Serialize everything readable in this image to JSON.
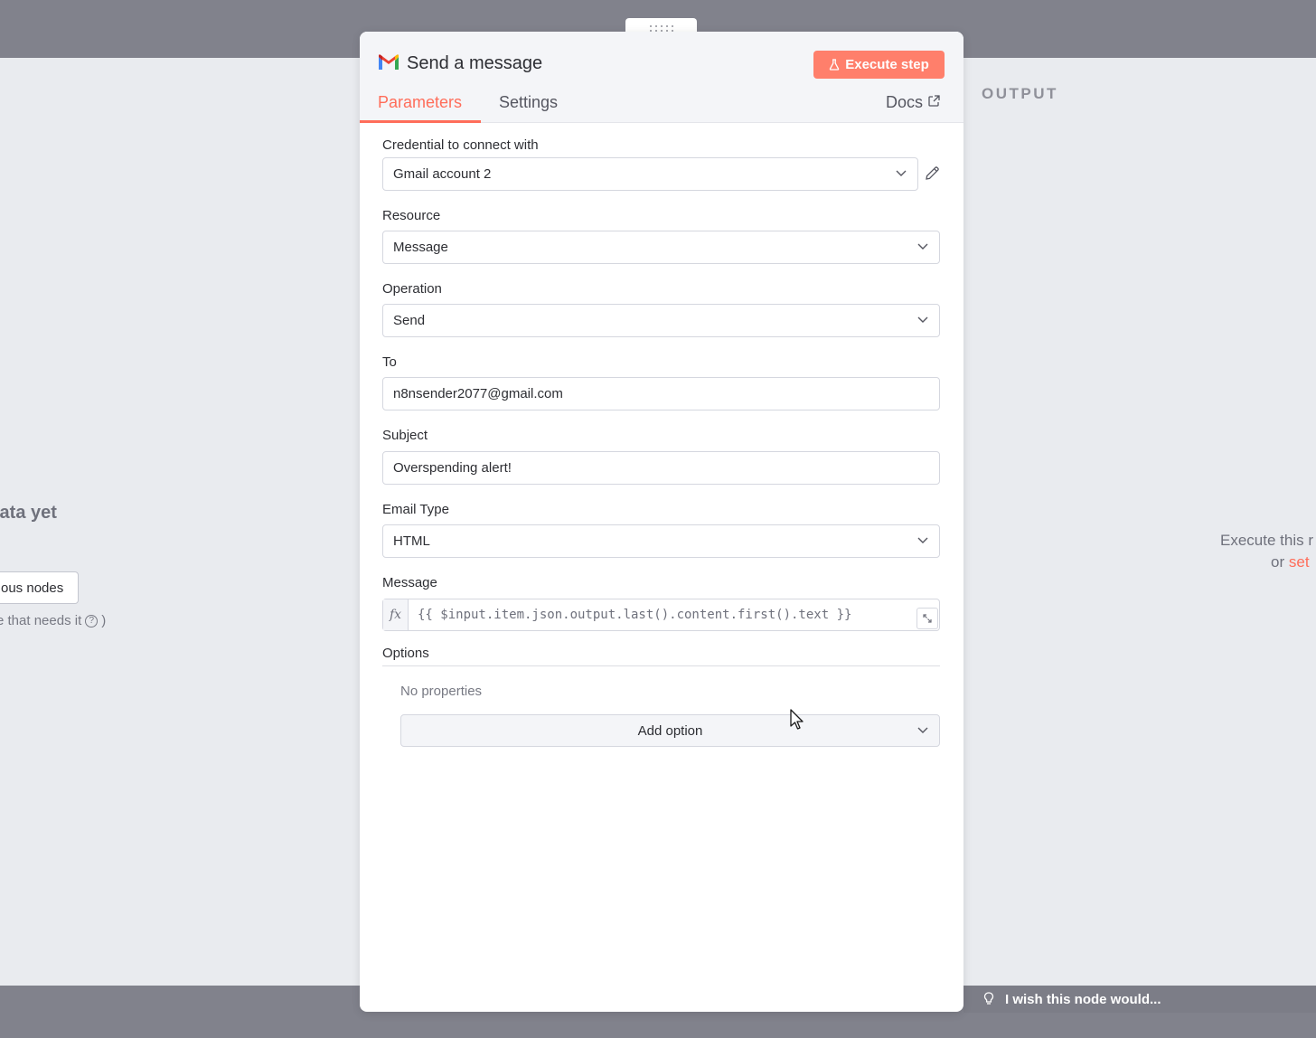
{
  "left_panel": {
    "no_data_text": "lata yet",
    "prev_nodes_button": "ous nodes",
    "hint_text": "e that needs it",
    "hint_icon": "question-circle-icon",
    "hint_suffix": ")"
  },
  "right_panel": {
    "output_label": "OUTPUT",
    "execute_text": "Execute this r",
    "or_text": "or",
    "set_link": "set"
  },
  "feedback": {
    "text": "I wish this node would..."
  },
  "node": {
    "icon": "gmail-icon",
    "title": "Send a message",
    "execute_button": "Execute step",
    "tabs": [
      {
        "label": "Parameters",
        "active": true
      },
      {
        "label": "Settings",
        "active": false
      }
    ],
    "docs_label": "Docs"
  },
  "params": {
    "credential": {
      "label": "Credential to connect with",
      "value": "Gmail account 2"
    },
    "resource": {
      "label": "Resource",
      "value": "Message"
    },
    "operation": {
      "label": "Operation",
      "value": "Send"
    },
    "to": {
      "label": "To",
      "value": "n8nsender2077@gmail.com"
    },
    "subject": {
      "label": "Subject",
      "value": "Overspending alert!"
    },
    "email_type": {
      "label": "Email Type",
      "value": "HTML"
    },
    "message": {
      "label": "Message",
      "fx": "fx",
      "value": "{{ $input.item.json.output.last().content.first().text }}"
    },
    "options": {
      "label": "Options",
      "no_properties": "No properties",
      "add_option": "Add option"
    }
  },
  "colors": {
    "accent": "#ff6d5a",
    "execute_button_bg": "#ff7f6b",
    "backdrop": "#81828c",
    "panel_bg": "#e9ebef"
  }
}
